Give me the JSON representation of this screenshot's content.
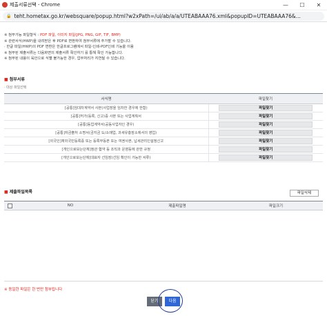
{
  "window": {
    "title": "제출서류선택 - Chrome",
    "url": "teht.hometax.go.kr/websquare/popup.html?w2xPath=/ui/ab/a/a/UTEABAAA76.xml&popupID=UTEABAAA76&..."
  },
  "notes": {
    "line1_prefix": "※ 첨부가능 파일형식 : ",
    "line1_red": "PDF 파일, 이미지 파일(JPG, PNG, GIF, TIF, BMP)",
    "line2": "※ 관련서식(HWP)을 내려받은 후 PDF로 변환하여 첨부서류에 추가할 수 있습니다.",
    "line3": "  · 한글 파일(HWP)의 PDF 변환은 한글프로그램에서 파일-인쇄-PDF인쇄 기능을 이용",
    "line4": "※ 첨부된 제출서류는 다음화면의 제출서류 확인하기 를 통해 확인 가능합니다.",
    "line5": "※ 첨부된 내용이 육안으로 식별 불가능한 경우, 업무처리가 지연될 수 있습니다."
  },
  "section1": {
    "title": "첨부서류",
    "subtitle": "· 대상 파일선택"
  },
  "doc_table": {
    "header_doc": "서식명",
    "header_action": "파일찾기",
    "find_label": "파일찾기",
    "rows": [
      {
        "name": "[공통]임대차계약서 사본(사업장을 임차한 경우에 한함)"
      },
      {
        "name": "[공통]허가(등록, 신고)증 사본 또는 사업계획서"
      },
      {
        "name": "[공통]동업계약서(공동사업자인 경우)"
      },
      {
        "name": "[공통]자금출처 소명서(금지금 도/소매업, 과세유흥장소에서의 영업)"
      },
      {
        "name": "[외국인]재외국민등록증 또는 등록부등본 또는 여권사본, 납세관리인설정신고"
      },
      {
        "name": "[개인으로보는단체]정관 협약 등 조직과 운영등에 관한 규정"
      },
      {
        "name": "[개인으로보는단체]대표자 선임장(선임 확인이 가능한 서류)"
      }
    ]
  },
  "section2": {
    "title": "제출파일목록",
    "delete_label": "파일삭제"
  },
  "file_table": {
    "header_no": "NO",
    "header_name": "제출파일명",
    "header_size": "파일크기"
  },
  "warning": "※ 동일한 파일은 한 번만 첨부됩니다",
  "buttons": {
    "close": "닫기",
    "next": "다음"
  }
}
